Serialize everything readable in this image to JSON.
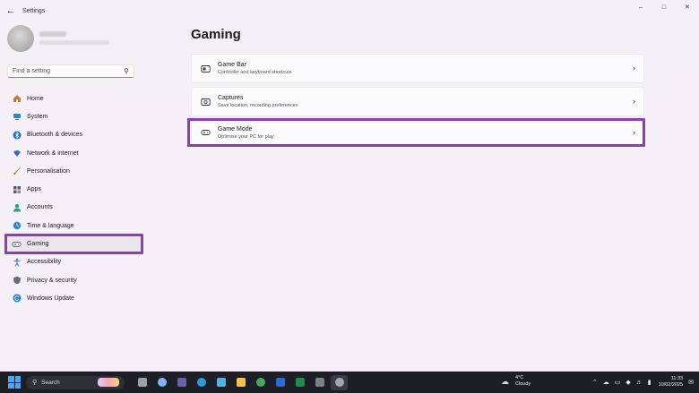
{
  "window": {
    "title": "Settings",
    "back_icon": "back-arrow-icon",
    "controls": [
      "minimize-icon",
      "maximize-icon",
      "close-icon"
    ]
  },
  "search": {
    "placeholder": "Find a setting",
    "value": ""
  },
  "sidebar": {
    "items": [
      {
        "label": "Home",
        "icon": "home-icon",
        "color": "#c9792f"
      },
      {
        "label": "System",
        "icon": "system-icon",
        "color": "#1f8ad8"
      },
      {
        "label": "Bluetooth & devices",
        "icon": "bluetooth-icon",
        "color": "#1f6fd0"
      },
      {
        "label": "Network & internet",
        "icon": "wifi-icon",
        "color": "#3a6fc4"
      },
      {
        "label": "Personalisation",
        "icon": "brush-icon",
        "color": "#d88c2a"
      },
      {
        "label": "Apps",
        "icon": "apps-icon",
        "color": "#5a5a6a"
      },
      {
        "label": "Accounts",
        "icon": "accounts-icon",
        "color": "#2aa37a"
      },
      {
        "label": "Time & language",
        "icon": "globe-clock-icon",
        "color": "#2a8ad0"
      },
      {
        "label": "Gaming",
        "icon": "gamepad-icon",
        "color": "#6b6b7b",
        "active": true
      },
      {
        "label": "Accessibility",
        "icon": "accessibility-icon",
        "color": "#2a7ad8"
      },
      {
        "label": "Privacy & security",
        "icon": "shield-icon",
        "color": "#6a6a7a"
      },
      {
        "label": "Windows Update",
        "icon": "update-icon",
        "color": "#1f7fd6"
      }
    ]
  },
  "main": {
    "title": "Gaming",
    "cards": [
      {
        "title": "Game Bar",
        "description": "Controller and keyboard shortcuts",
        "icon": "game-bar-icon"
      },
      {
        "title": "Captures",
        "description": "Save location, recording preferences",
        "icon": "capture-icon"
      },
      {
        "title": "Game Mode",
        "description": "Optimise your PC for play",
        "icon": "game-mode-icon"
      }
    ]
  },
  "taskbar": {
    "search_label": "Search",
    "apps": [
      {
        "icon": "task-view-icon",
        "color": "#9aa0a8"
      },
      {
        "icon": "copilot-icon",
        "color": "#7fb3ff"
      },
      {
        "icon": "teams-icon",
        "color": "#6264a7"
      },
      {
        "icon": "edge-icon",
        "color": "#2e9ad8"
      },
      {
        "icon": "notepad-icon",
        "color": "#4fb3e0"
      },
      {
        "icon": "file-explorer-icon",
        "color": "#f2c14e"
      },
      {
        "icon": "chrome-icon",
        "color": "#4aa65a"
      },
      {
        "icon": "word-icon",
        "color": "#2b6ad3"
      },
      {
        "icon": "excel-icon",
        "color": "#1f8a4c"
      },
      {
        "icon": "calculator-icon",
        "color": "#7a7f8a"
      },
      {
        "icon": "settings-icon",
        "color": "#a0a6b0",
        "active": true
      }
    ],
    "weather": {
      "temp": "4°C",
      "condition": "Cloudy",
      "icon": "cloud-icon"
    },
    "clock": {
      "time": "11:33",
      "date": "10/02/2025"
    }
  }
}
